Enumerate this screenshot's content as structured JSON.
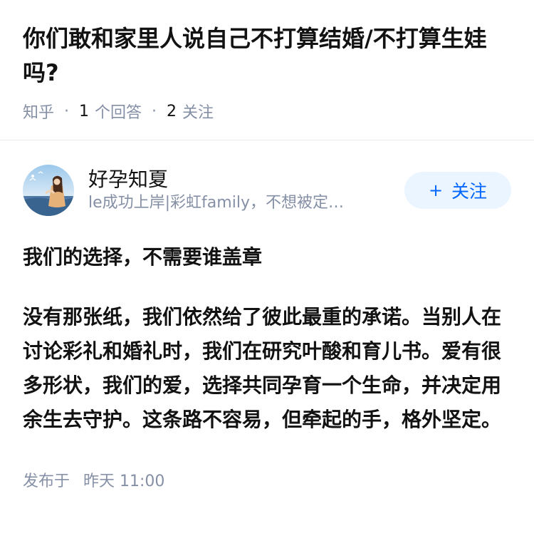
{
  "question": {
    "title": "你们敢和家里人说自己不打算结婚/不打算生娃吗?",
    "source": "知乎",
    "answer_count": "1",
    "answer_label": "个回答",
    "follow_count": "2",
    "follow_label": "关注"
  },
  "answer": {
    "author": {
      "name": "好孕知夏",
      "bio": "le成功上岸|彩虹family，不想被定…",
      "avatar_icon": "avatar-photo-icon"
    },
    "follow_button": {
      "icon": "plus-icon",
      "label": "关注"
    },
    "paragraphs": [
      "我们的选择，不需要谁盖章",
      "没有那张纸，我们依然给了彼此最重的承诺。当别人在讨论彩礼和婚礼时，我们在研究叶酸和育儿书。爱有很多形状，我们的爱，选择共同孕育一个生命，并决定用余生去守护。这条路不容易，但牵起的手，格外坚定。"
    ],
    "publish": {
      "label": "发布于",
      "time": "昨天 11:00"
    }
  },
  "colors": {
    "text_primary": "#121212",
    "text_secondary": "#8590a6",
    "accent": "#0066ff",
    "follow_bg": "#ebf5ff"
  }
}
